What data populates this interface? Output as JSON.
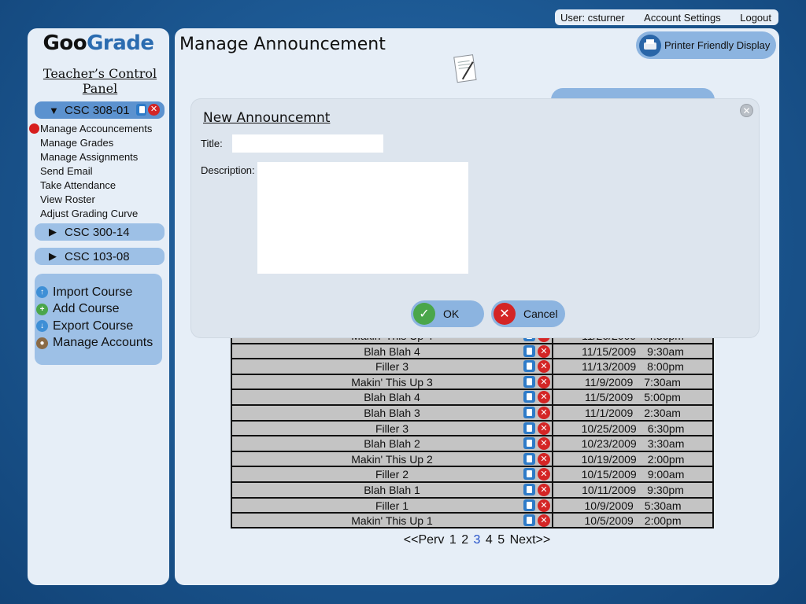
{
  "userbar": {
    "user": "User: csturner",
    "account_settings": "Account Settings",
    "logout": "Logout"
  },
  "sidebar": {
    "logo_part1": "Goo",
    "logo_part2": "Grade",
    "panel_title": "Teacher’s Control Panel",
    "courses": [
      {
        "label": "CSC 308-01",
        "expanded": true
      },
      {
        "label": "CSC 300-14",
        "expanded": false
      },
      {
        "label": "CSC 103-08",
        "expanded": false
      }
    ],
    "menu": [
      "Manage Accouncements",
      "Manage Grades",
      "Manage Assignments",
      "Send Email",
      "Take Attendance",
      "View Roster",
      "Adjust Grading Curve"
    ],
    "actions": [
      "Import Course",
      "Add Course",
      "Export Course",
      "Manage Accounts"
    ]
  },
  "main": {
    "title": "Manage Announcement",
    "printer_button": "Printer Friendly Display",
    "partial_row": {
      "title": "Makin' This Up 4",
      "date": "11/20/2009",
      "time": "4:30pm"
    },
    "rows": [
      {
        "title": "Blah Blah 4",
        "date": "11/15/2009",
        "time": "9:30am"
      },
      {
        "title": "Filler 3",
        "date": "11/13/2009",
        "time": "8:00pm"
      },
      {
        "title": "Makin' This Up 3",
        "date": "11/9/2009",
        "time": "7:30am"
      },
      {
        "title": "Blah Blah 4",
        "date": "11/5/2009",
        "time": "5:00pm"
      },
      {
        "title": "Blah Blah 3",
        "date": "11/1/2009",
        "time": "2:30am"
      },
      {
        "title": "Filler 3",
        "date": "10/25/2009",
        "time": "6:30pm"
      },
      {
        "title": "Blah Blah 2",
        "date": "10/23/2009",
        "time": "3:30am"
      },
      {
        "title": "Makin' This Up 2",
        "date": "10/19/2009",
        "time": "2:00pm"
      },
      {
        "title": "Filler 2",
        "date": "10/15/2009",
        "time": "9:00am"
      },
      {
        "title": "Blah Blah 1",
        "date": "10/11/2009",
        "time": "9:30pm"
      },
      {
        "title": "Filler 1",
        "date": "10/9/2009",
        "time": "5:30am"
      },
      {
        "title": "Makin' This Up 1",
        "date": "10/5/2009",
        "time": "2:00pm"
      }
    ],
    "pager": {
      "prev": "<<Perv",
      "pages": [
        "1",
        "2",
        "3",
        "4",
        "5"
      ],
      "current": "3",
      "next": "Next>>"
    }
  },
  "modal": {
    "title": "New Announcemnt",
    "title_label": "Title:",
    "title_value": "",
    "description_label": "Description:",
    "description_value": "",
    "ok": "OK",
    "cancel": "Cancel"
  },
  "colors": {
    "accent_blue": "#8cb4e0",
    "active_course": "#5c92cf",
    "panel_bg": "#e6eef7",
    "delete_red": "#d42525"
  }
}
